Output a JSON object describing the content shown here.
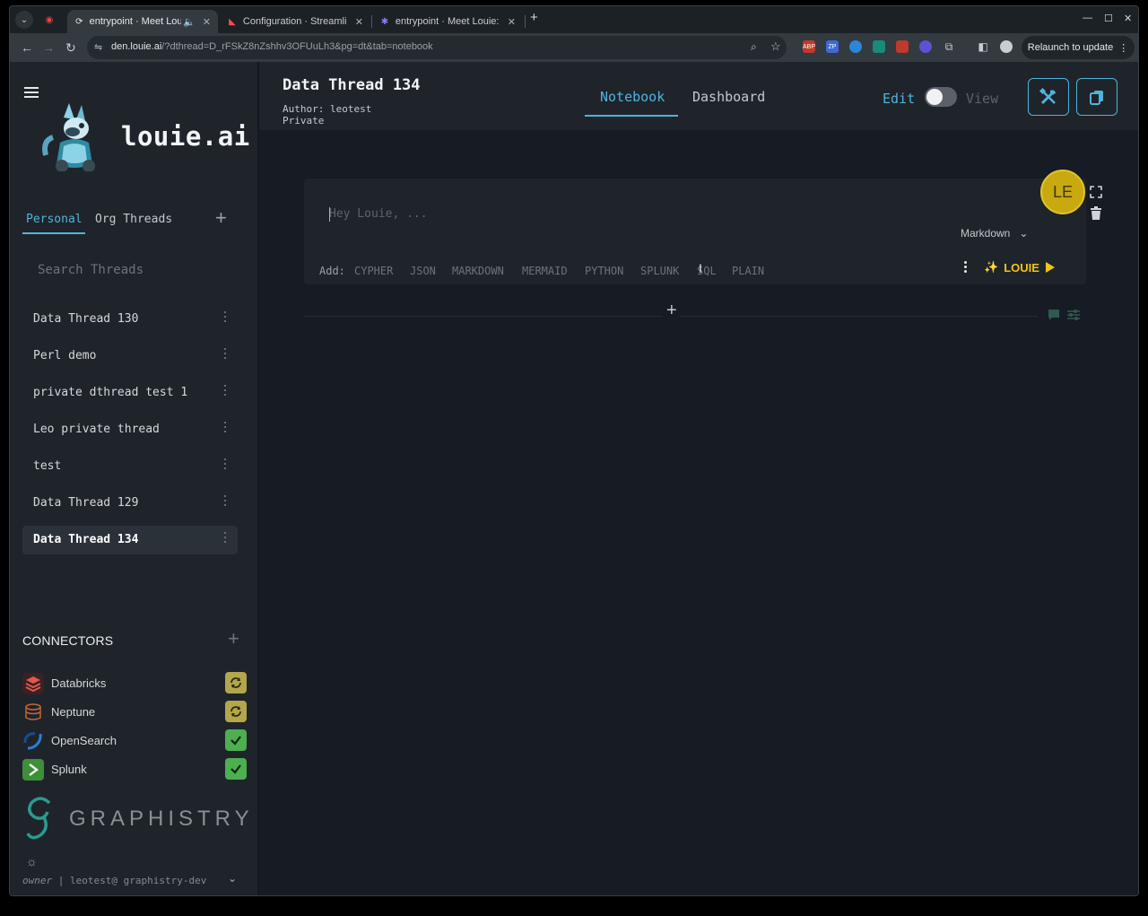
{
  "browser": {
    "tabs": [
      {
        "title": "entrypoint · Meet Lou",
        "active": true
      },
      {
        "title": "Configuration · Streamli",
        "active": false
      },
      {
        "title": "entrypoint · Meet Louie:",
        "active": false
      }
    ],
    "url_host": "den.louie.ai",
    "url_path": "/?dthread=D_rFSkZ8nZshhv3OFUuLh3&pg=dt&tab=notebook",
    "relaunch_label": "Relaunch to update",
    "extensions": [
      "ABP",
      "ZP",
      "",
      "",
      "",
      "",
      ""
    ]
  },
  "sidebar": {
    "brand": "louie.ai",
    "tabs": {
      "personal": "Personal",
      "org": "Org Threads"
    },
    "search_placeholder": "Search Threads",
    "threads": [
      {
        "label": "Data Thread 130"
      },
      {
        "label": "Perl demo"
      },
      {
        "label": "private dthread test 1"
      },
      {
        "label": "Leo private thread"
      },
      {
        "label": "test"
      },
      {
        "label": "Data Thread 129"
      },
      {
        "label": "Data Thread 134",
        "selected": true
      }
    ],
    "connectors_title": "CONNECTORS",
    "connectors": [
      {
        "name": "Databricks",
        "status": "syncing"
      },
      {
        "name": "Neptune",
        "status": "syncing"
      },
      {
        "name": "OpenSearch",
        "status": "ok"
      },
      {
        "name": "Splunk",
        "status": "ok"
      }
    ],
    "graphistry_text": "GRAPHISTRY",
    "user": {
      "role": "owner",
      "sep": " | ",
      "account": "leotest@ graphistry-dev"
    }
  },
  "header": {
    "title": "Data Thread 134",
    "author": "Author: leotest",
    "privacy": "Private",
    "tabs": {
      "notebook": "Notebook",
      "dashboard": "Dashboard"
    },
    "edit_label": "Edit",
    "view_label": "View"
  },
  "cell": {
    "placeholder": "Hey Louie, ...",
    "language": "Markdown",
    "add_label": "Add:",
    "add_types": [
      "CYPHER",
      "JSON",
      "MARKDOWN",
      "MERMAID",
      "PYTHON",
      "SPLUNK",
      "SQL",
      "PLAIN"
    ],
    "run_label": "LOUIE"
  },
  "avatar_initials": "LE",
  "colors": {
    "accent": "#4fb4dc",
    "louie": "#f0c419",
    "avatar": "#c8a90f",
    "ok": "#4caf50",
    "sync": "#b4a64a"
  }
}
